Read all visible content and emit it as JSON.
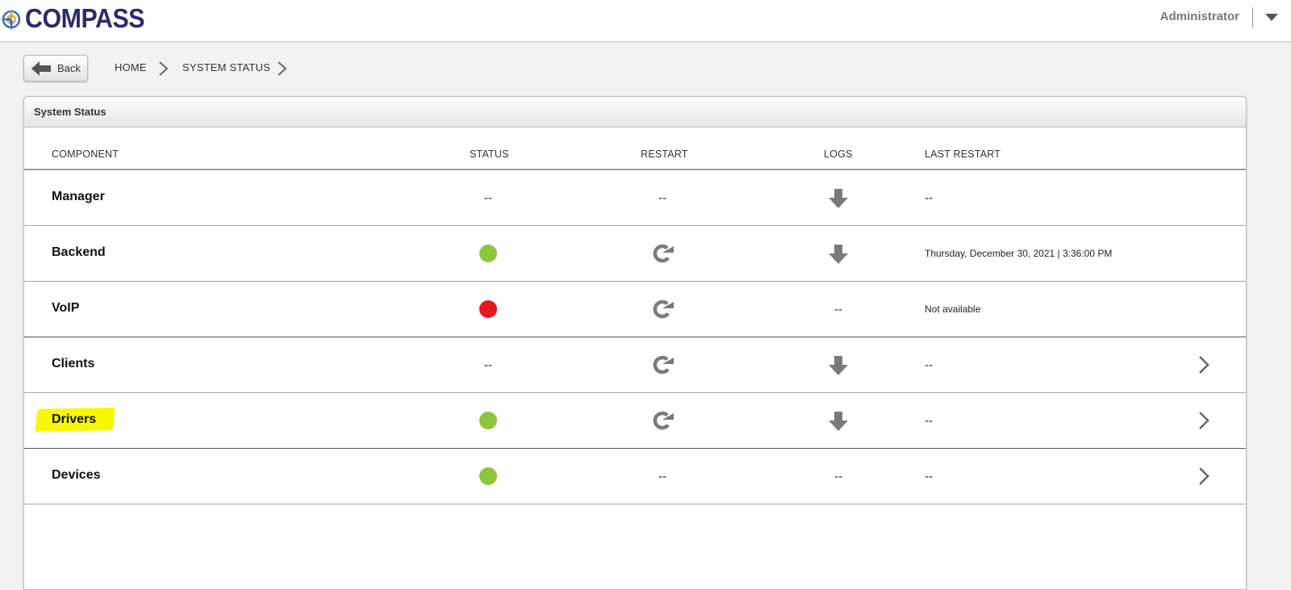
{
  "header": {
    "logo_text": "COMPASS",
    "user_name": "Administrator"
  },
  "breadcrumb": {
    "back_label": "Back",
    "items": [
      "HOME",
      "SYSTEM STATUS"
    ]
  },
  "panel": {
    "title": "System Status",
    "columns": [
      "COMPONENT",
      "STATUS",
      "RESTART",
      "LOGS",
      "LAST RESTART"
    ]
  },
  "colors": {
    "status_ok": "#8cc63f",
    "status_error": "#e8161e",
    "highlight": "#f7f700",
    "logo_text": "#2d2a6b"
  },
  "rows": [
    {
      "component": "Manager",
      "status": "--",
      "restart": "--",
      "logs": "download-icon",
      "last_restart": "--",
      "has_chevron": false
    },
    {
      "component": "Backend",
      "status": "ok",
      "restart": "restart-icon",
      "logs": "download-icon",
      "last_restart": "Thursday, December 30, 2021 | 3:36:00 PM",
      "has_chevron": false
    },
    {
      "component": "VoIP",
      "status": "error",
      "restart": "restart-icon",
      "logs": "--",
      "last_restart": "Not available",
      "has_chevron": false
    },
    {
      "component": "Clients",
      "status": "--",
      "restart": "restart-icon",
      "logs": "download-icon",
      "last_restart": "--",
      "has_chevron": true
    },
    {
      "component": "Drivers",
      "status": "ok",
      "restart": "restart-icon",
      "logs": "download-icon",
      "last_restart": "--",
      "has_chevron": true,
      "highlighted": true
    },
    {
      "component": "Devices",
      "status": "ok",
      "restart": "--",
      "logs": "--",
      "last_restart": "--",
      "has_chevron": true
    }
  ]
}
